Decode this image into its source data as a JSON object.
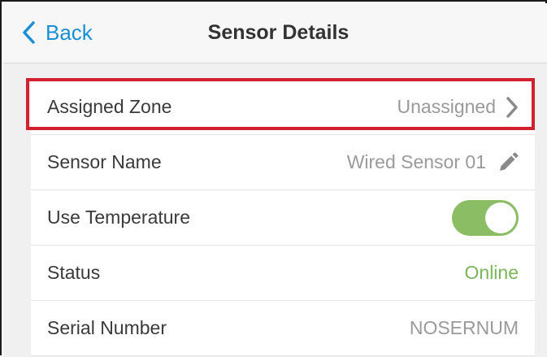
{
  "header": {
    "back_label": "Back",
    "title": "Sensor Details"
  },
  "rows": [
    {
      "label": "Assigned Zone",
      "value": "Unassigned",
      "action_icon": "chevron-right-icon"
    },
    {
      "label": "Sensor Name",
      "value": "Wired Sensor 01",
      "action_icon": "pencil-icon"
    },
    {
      "label": "Use Temperature",
      "toggle_on": true
    },
    {
      "label": "Status",
      "value": "Online"
    },
    {
      "label": "Serial Number",
      "value": "NOSERNUM"
    }
  ],
  "colors": {
    "accent": "#1a8fd6",
    "highlight": "#d2202f",
    "toggle_on": "#8bbd64",
    "status_online": "#7ab55c"
  }
}
